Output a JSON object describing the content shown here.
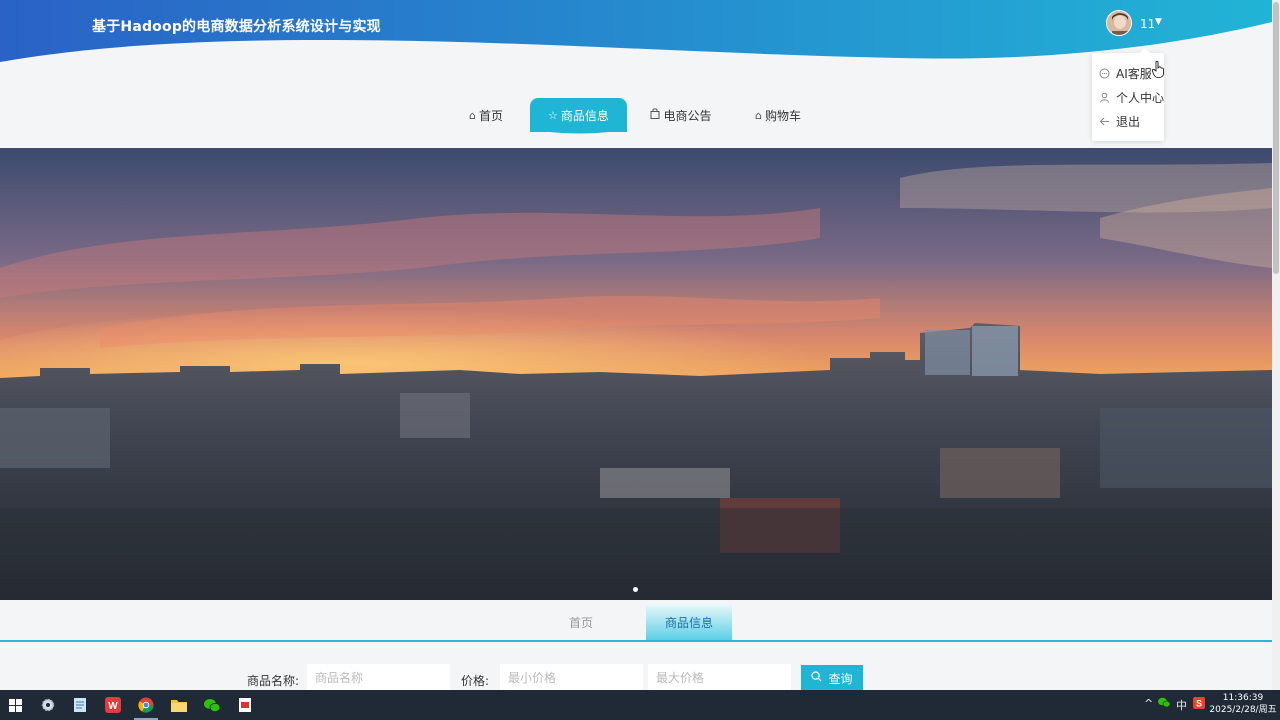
{
  "header": {
    "title": "基于Hadoop的电商数据分析系统设计与实现",
    "user_name": "11"
  },
  "user_menu": {
    "items": [
      {
        "label": "AI客服",
        "icon": "chat-icon"
      },
      {
        "label": "个人中心",
        "icon": "user-icon"
      },
      {
        "label": "退出",
        "icon": "logout-icon"
      }
    ]
  },
  "nav": {
    "items": [
      {
        "label": "首页",
        "icon": "home-icon"
      },
      {
        "label": "商品信息",
        "icon": "star-icon",
        "active": true
      },
      {
        "label": "电商公告",
        "icon": "bag-icon"
      },
      {
        "label": "购物车",
        "icon": "home-icon"
      }
    ]
  },
  "banner": {
    "slide_count": 1,
    "active_slide": 1
  },
  "breadcrumb": {
    "home": "首页",
    "current": "商品信息"
  },
  "search": {
    "name_label": "商品名称:",
    "name_placeholder": "商品名称",
    "price_label": "价格:",
    "min_price_placeholder": "最小价格",
    "max_price_placeholder": "最大价格",
    "query_label": "查询"
  },
  "taskbar": {
    "tray_lang": "中",
    "time": "11:36:39",
    "date": "2025/2/28/周五"
  },
  "colors": {
    "accent": "#1fb6d6",
    "header_start": "#2a64c7",
    "header_end": "#2ab7d3",
    "taskbar": "#1f2a36"
  }
}
